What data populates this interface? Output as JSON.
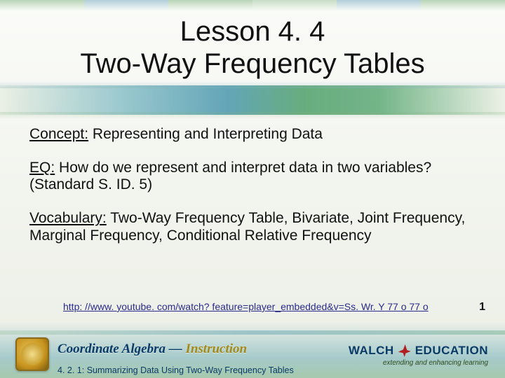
{
  "title_line1": "Lesson 4. 4",
  "title_line2": "Two-Way Frequency Tables",
  "concept": {
    "label": "Concept:",
    "text": " Representing and Interpreting Data"
  },
  "eq": {
    "label": "EQ:",
    "text": " How do we represent and interpret data in two variables? (Standard S. ID. 5)"
  },
  "vocab": {
    "label": "Vocabulary:",
    "text": " Two-Way Frequency Table, Bivariate, Joint Frequency, Marginal Frequency, Conditional Relative Frequency"
  },
  "link": "http: //www. youtube. com/watch? feature=player_embedded&v=Ss. Wr. Y 77 o 77 o",
  "page_number": "1",
  "brand": {
    "main": "Coordinate Algebra",
    "dash": " — ",
    "accent": "Instruction",
    "sub": "4. 2. 1: Summarizing Data Using Two-Way Frequency Tables"
  },
  "walch": {
    "name": "WALCH",
    "edu": "EDUCATION",
    "tag": "extending and enhancing learning"
  }
}
